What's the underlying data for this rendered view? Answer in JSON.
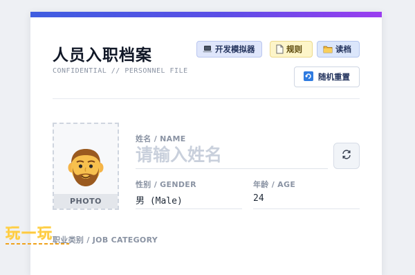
{
  "header": {
    "title": "人员入职档案",
    "subtitle": "CONFIDENTIAL // PERSONNEL FILE"
  },
  "toolbar": {
    "dev_sim": {
      "label": "开发模拟器",
      "icon": "laptop-icon"
    },
    "rules": {
      "label": "规则",
      "icon": "document-icon"
    },
    "load": {
      "label": "读档",
      "icon": "folder-icon"
    },
    "reset": {
      "label": "随机重置",
      "icon": "shuffle-reset-icon"
    }
  },
  "photo": {
    "caption": "PHOTO",
    "avatar": "bearded-man-avatar"
  },
  "form": {
    "name": {
      "label": "姓名 / NAME",
      "placeholder": "请输入姓名",
      "value": ""
    },
    "regenerate_icon": "refresh-icon",
    "gender": {
      "label": "性别 / GENDER",
      "value": "男 (Male)"
    },
    "age": {
      "label": "年龄 / AGE",
      "value": "24"
    },
    "job_category": {
      "label": "职业类别 / JOB CATEGORY"
    }
  },
  "watermark": {
    "text": "玩一玩"
  },
  "colors": {
    "accent_gradient_start": "#3f5de0",
    "accent_gradient_end": "#9b3df0",
    "watermark": "#f08a1c"
  }
}
